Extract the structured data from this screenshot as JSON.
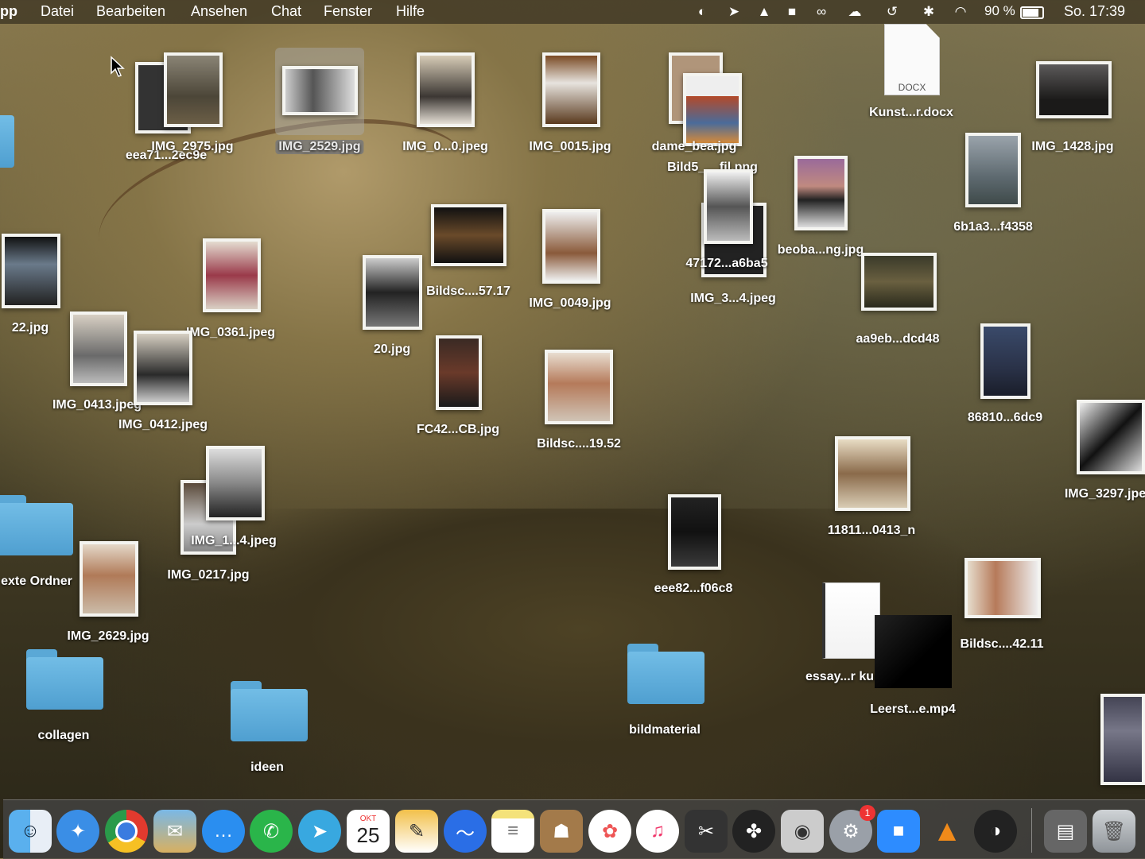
{
  "menubar": {
    "app": "pp",
    "menus": [
      "Datei",
      "Bearbeiten",
      "Ansehen",
      "Chat",
      "Fenster",
      "Hilfe"
    ],
    "battery": "90 %",
    "clock": "So. 17:39"
  },
  "desktop": {
    "files": {
      "f1": "eea71...2ec9e",
      "f2": "IMG_2975.jpg",
      "f3": "IMG_2529.jpg",
      "f4": "IMG_0...0.jpeg",
      "f5": "IMG_0015.jpg",
      "f6": "dame_bea.jpg",
      "f7": "Bild5___fil.png",
      "f8": "Kunst...r.docx",
      "f9": "IMG_1428.jpg",
      "f10": "6b1a3...f4358",
      "f11": "beoba...ng.jpg",
      "f12": "47172...a6ba5",
      "f13": "IMG_3...4.jpeg",
      "f14": "22.jpg",
      "f15": "IMG_0361.jpeg",
      "f16": "Bildsc....57.17",
      "f17": "IMG_0049.jpg",
      "f18": "20.jpg",
      "f19": "aa9eb...dcd48",
      "f20": "IMG_0413.jpeg",
      "f21": "IMG_0412.jpeg",
      "f22": "FC42...CB.jpg",
      "f23": "Bildsc....19.52",
      "f24": "86810...6dc9",
      "f25": "IMG_3297.jpe",
      "f26": "IMG_1...4.jpeg",
      "f27": "IMG_0217.jpg",
      "f28": "11811...0413_n",
      "f29": "exte Ordner",
      "f30": "IMG_2629.jpg",
      "f31": "eee82...f06c8",
      "f32": "essay...r kunst",
      "f33": "Bildsc....42.11",
      "f34": "Leerst...e.mp4",
      "f35": "collagen",
      "f36": "ideen",
      "f37": "bildmaterial"
    },
    "docx_label": "DOCX"
  },
  "dock": {
    "calendar_month": "OKT",
    "calendar_day": "25",
    "settings_badge": "1"
  },
  "colors": {
    "folder": "#5aa8d6",
    "menubar": "#3c3422",
    "badge": "#e33333"
  }
}
